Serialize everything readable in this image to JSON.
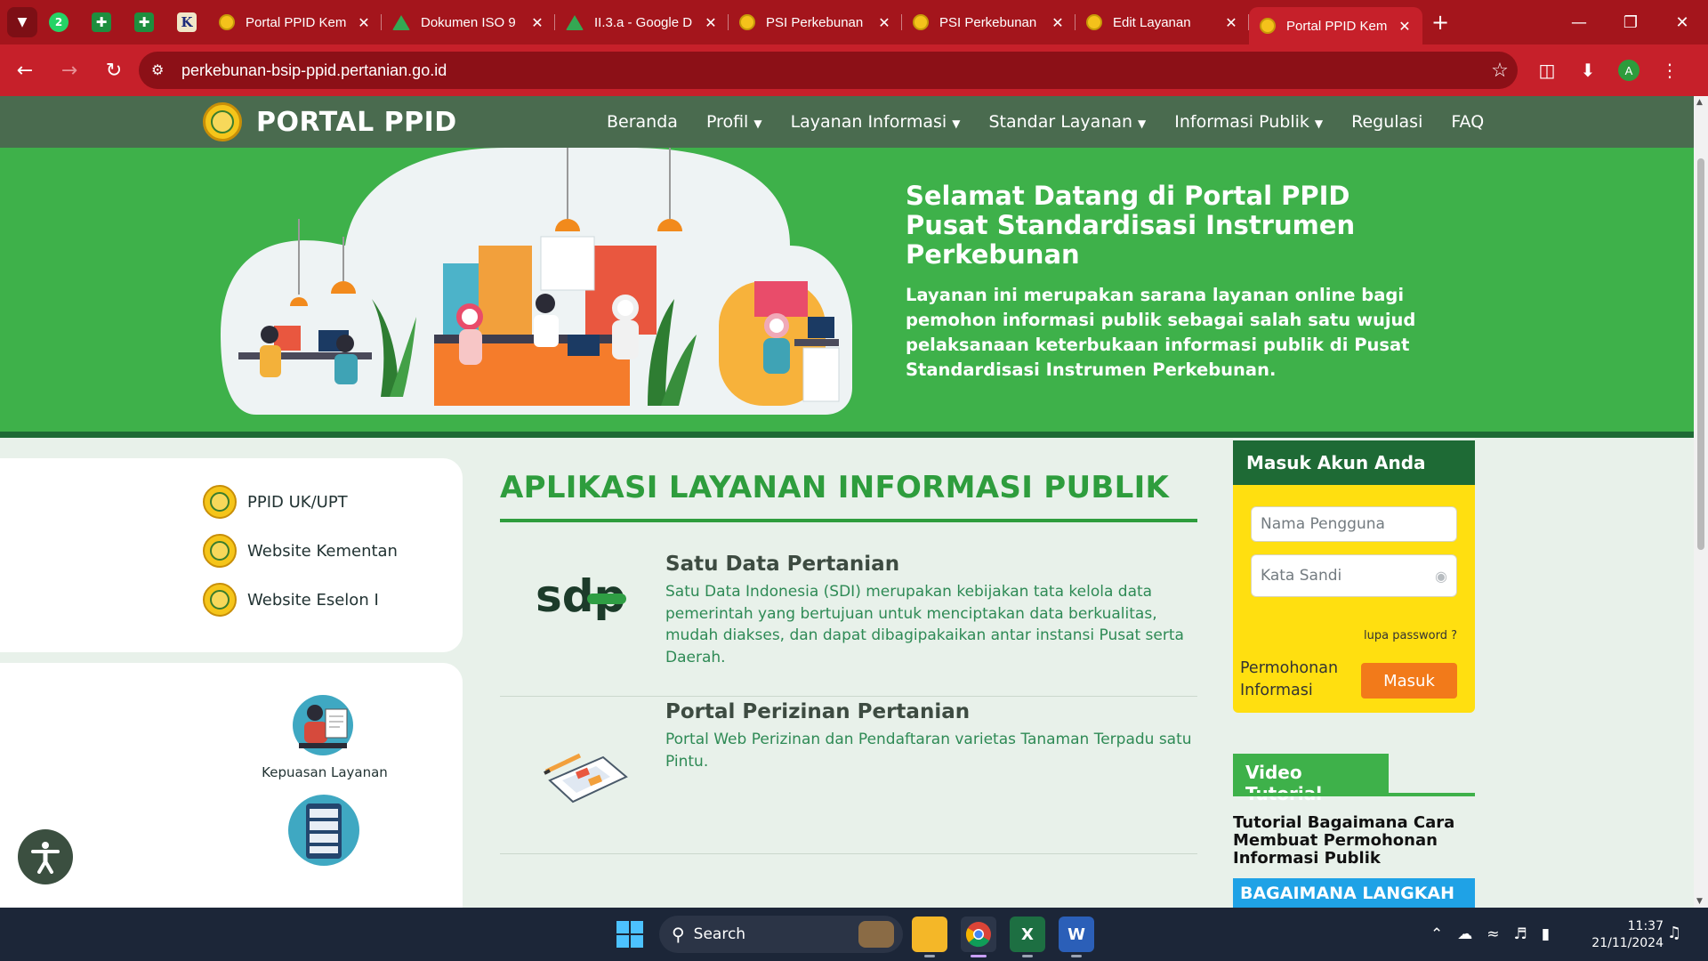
{
  "browser": {
    "tabs": [
      {
        "label": "Portal PPID Kem",
        "icon": "ppid-favicon",
        "active": false
      },
      {
        "label": "Dokumen ISO 9",
        "icon": "google-drive-favicon",
        "active": false
      },
      {
        "label": "II.3.a - Google D",
        "icon": "google-drive-favicon",
        "active": false
      },
      {
        "label": "PSI Perkebunan",
        "icon": "ppid-favicon",
        "active": false
      },
      {
        "label": "PSI Perkebunan",
        "icon": "ppid-favicon",
        "active": false
      },
      {
        "label": "Edit Layanan",
        "icon": "ppid-favicon",
        "active": false
      },
      {
        "label": "Portal PPID Kem",
        "icon": "ppid-favicon",
        "active": true
      }
    ],
    "pinned_badge": "2",
    "pinned_k": "K",
    "url": "perkebunan-bsip-ppid.pertanian.go.id",
    "profile_initial": "A",
    "colors": {
      "tabbar": "#a4151c",
      "toolbar": "#c6202a"
    }
  },
  "site": {
    "logo_text": "PORTAL PPID",
    "menu": [
      {
        "label": "Beranda",
        "dropdown": false
      },
      {
        "label": "Profil",
        "dropdown": true
      },
      {
        "label": "Layanan Informasi",
        "dropdown": true
      },
      {
        "label": "Standar Layanan",
        "dropdown": true
      },
      {
        "label": "Informasi Publik",
        "dropdown": true
      },
      {
        "label": "Regulasi",
        "dropdown": false
      },
      {
        "label": "FAQ",
        "dropdown": false
      }
    ],
    "colors": {
      "nav": "#4a6b4f",
      "hero": "#3eb14a",
      "accent_green": "#2e9d3d",
      "login_bg": "#ffdf10",
      "button_orange": "#f27a1a"
    }
  },
  "hero": {
    "title": "Selamat Datang di Portal PPID Pusat Standardisasi Instrumen Perkebunan",
    "text": "Layanan ini merupakan sarana layanan online bagi pemohon informasi publik sebagai salah satu wujud pelaksanaan keterbukaan informasi publik di Pusat Standardisasi Instrumen Perkebunan."
  },
  "links": [
    {
      "label": "PPID UK/UPT"
    },
    {
      "label": "Website Kementan"
    },
    {
      "label": "Website Eselon I"
    }
  ],
  "services": [
    {
      "label": "Kepuasan Layanan",
      "icon": "survey-person-icon"
    },
    {
      "label": "",
      "icon": "server-cabinet-icon"
    }
  ],
  "apps": {
    "title": "APLIKASI LAYANAN INFORMASI PUBLIK",
    "items": [
      {
        "name": "Satu Data Pertanian",
        "logo": "sdp-logo",
        "logo_text": "sdp",
        "desc": "Satu Data Indonesia (SDI) merupakan kebijakan tata kelola data pemerintah yang bertujuan untuk menciptakan data berkualitas, mudah diakses, dan dapat dibagipakaikan antar instansi Pusat serta Daerah."
      },
      {
        "name": "Portal Perizinan Pertanian",
        "logo": "document-pen-icon",
        "desc": "Portal Web Perizinan dan Pendaftaran varietas Tanaman Terpadu satu Pintu."
      }
    ]
  },
  "login": {
    "title": "Masuk Akun Anda",
    "username_placeholder": "Nama Pengguna",
    "password_placeholder": "Kata Sandi",
    "forgot": "lupa password ?",
    "permohonan": "Permohonan Informasi",
    "submit": "Masuk"
  },
  "video": {
    "tab": "Video Tutorial",
    "title": "Tutorial Bagaimana Cara Membuat Permohonan Informasi Publik",
    "thumb_text": "BAGAIMANA LANGKAH"
  },
  "taskbar": {
    "search_label": "Search",
    "time": "11:37",
    "date": "21/11/2024",
    "apps": [
      "file-explorer-icon",
      "chrome-icon",
      "excel-icon",
      "word-icon"
    ]
  }
}
